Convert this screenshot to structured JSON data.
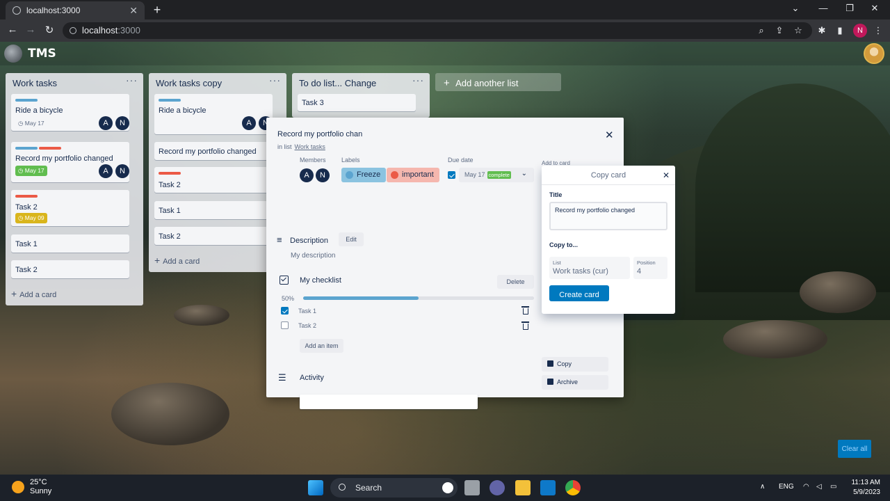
{
  "browser": {
    "tab_title": "localhost:3000",
    "url_host": "localhost",
    "url_port": ":3000",
    "profile_initial": "N"
  },
  "app": {
    "brand": "TMS"
  },
  "lists": [
    {
      "title": "Work tasks",
      "cards": [
        {
          "title": "Ride a bicycle",
          "due": "May 17",
          "due_style": "plain",
          "members": [
            "A",
            "N"
          ],
          "labels": [
            "#5ba4cf"
          ]
        },
        {
          "title": "Record my portfolio changed",
          "due": "May 17",
          "due_style": "green",
          "members": [
            "A",
            "N"
          ],
          "labels": [
            "#5ba4cf",
            "#eb5a46"
          ]
        },
        {
          "title": "Task 2",
          "due": "May 09",
          "due_style": "yellow",
          "members": [],
          "labels": [
            "#eb5a46"
          ]
        },
        {
          "title": "Task 1"
        },
        {
          "title": "Task 2"
        }
      ],
      "add_card": "Add a card"
    },
    {
      "title": "Work tasks copy",
      "cards": [
        {
          "title": "Ride a bicycle",
          "members": [
            "A",
            "N"
          ],
          "labels": [
            "#5ba4cf"
          ]
        },
        {
          "title": "Record my portfolio changed"
        },
        {
          "title": "Task 2",
          "labels": [
            "#eb5a46"
          ]
        },
        {
          "title": "Task 1"
        },
        {
          "title": "Task 2"
        }
      ],
      "add_card": "Add a card"
    },
    {
      "title": "To do list... Change",
      "cards": [
        {
          "title": "Task 3"
        }
      ]
    }
  ],
  "add_list": "Add another list",
  "modal": {
    "title": "Record my portfolio changed",
    "in_list_prefix": "in list",
    "in_list_name": "Work tasks",
    "members_label": "Members",
    "members": [
      "A",
      "N"
    ],
    "labels_label": "Labels",
    "labels": [
      {
        "name": "Freeze",
        "bg": "#8bc3e0",
        "dot": "#5ba4cf"
      },
      {
        "name": "important",
        "bg": "#f5b7ae",
        "dot": "#eb5a46"
      }
    ],
    "due_label": "Due date",
    "due_value": "May 17",
    "due_status": "complete",
    "add_to_card": "Add to card",
    "description_title": "Description",
    "edit_button": "Edit",
    "description_text": "My description",
    "checklist_title": "My checklist",
    "delete_button": "Delete",
    "progress_text": "50%",
    "progress": 0.5,
    "items": [
      {
        "label": "Task 1",
        "checked": true
      },
      {
        "label": "Task 2",
        "checked": false
      }
    ],
    "add_item": "Add an item",
    "activity_title": "Activity",
    "copy_button": "Copy",
    "archive_button": "Archive"
  },
  "copy_popover": {
    "header": "Copy card",
    "title_label": "Title",
    "title_value": "Record my portfolio changed",
    "copy_to": "Copy to...",
    "list_label": "List",
    "list_value": "Work tasks (cur)",
    "position_label": "Position",
    "position_value": "4",
    "create_button": "Create card"
  },
  "clear_all": "Clear all",
  "taskbar": {
    "temp": "25°C",
    "weather": "Sunny",
    "search": "Search",
    "lang": "ENG",
    "time": "11:13 AM",
    "date": "5/9/2023"
  }
}
